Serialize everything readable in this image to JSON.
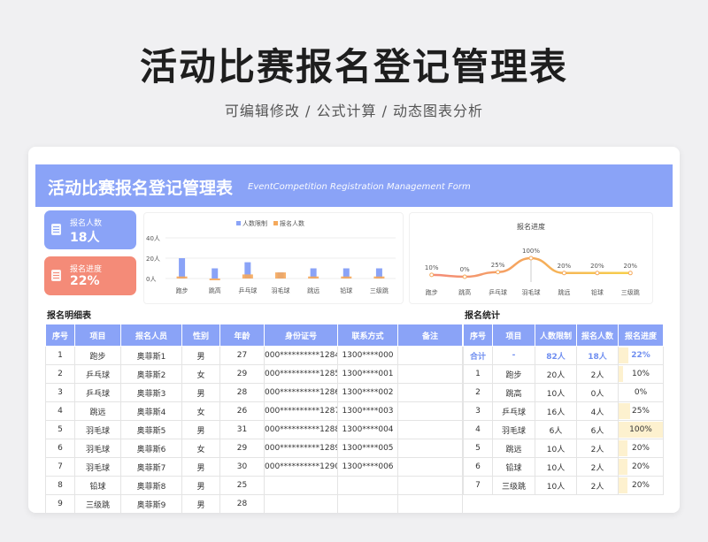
{
  "page": {
    "title": "活动比赛报名登记管理表",
    "subtitle": "可编辑修改 /  公式计算  /  动态图表分析"
  },
  "banner": {
    "title": "活动比赛报名登记管理表",
    "subtitle": "EventCompetition Registration Management Form"
  },
  "stats": {
    "count_label": "报名人数",
    "count_value": "18人",
    "progress_label": "报名进度",
    "progress_value": "22%"
  },
  "colors": {
    "accent": "#8aa3f7",
    "orange": "#f5a95c",
    "coral": "#f48b78",
    "progress_fill": "#fdf1cf"
  },
  "chart_data": [
    {
      "type": "bar",
      "categories": [
        "跑步",
        "跳高",
        "乒乓球",
        "羽毛球",
        "跳远",
        "铅球",
        "三级跳"
      ],
      "series": [
        {
          "name": "人数限制",
          "values": [
            20,
            10,
            16,
            6,
            10,
            10,
            10
          ]
        },
        {
          "name": "报名人数",
          "values": [
            2,
            0,
            4,
            6,
            2,
            2,
            2
          ]
        }
      ],
      "yticks": [
        "40人",
        "20人",
        "0人"
      ],
      "ylim": [
        0,
        40
      ],
      "legend": "top",
      "grid": true
    },
    {
      "type": "line",
      "title": "报名进度",
      "categories": [
        "跑步",
        "跳高",
        "乒乓球",
        "羽毛球",
        "跳远",
        "铅球",
        "三级跳"
      ],
      "values": [
        10,
        0,
        25,
        100,
        20,
        20,
        20
      ],
      "labels": [
        "10%",
        "0%",
        "25%",
        "100%",
        "20%",
        "20%",
        "20%"
      ]
    }
  ],
  "detail": {
    "section_label": "报名明细表",
    "headers": [
      "序号",
      "项目",
      "报名人员",
      "性别",
      "年龄",
      "身份证号",
      "联系方式",
      "备注"
    ],
    "rows": [
      [
        "1",
        "跑步",
        "奥菲斯1",
        "男",
        "27",
        "000**********1284",
        "1300****000",
        ""
      ],
      [
        "2",
        "乒乓球",
        "奥菲斯2",
        "女",
        "29",
        "000**********1285",
        "1300****001",
        ""
      ],
      [
        "3",
        "乒乓球",
        "奥菲斯3",
        "男",
        "28",
        "000**********1286",
        "1300****002",
        ""
      ],
      [
        "4",
        "跳远",
        "奥菲斯4",
        "女",
        "26",
        "000**********1287",
        "1300****003",
        ""
      ],
      [
        "5",
        "羽毛球",
        "奥菲斯5",
        "男",
        "31",
        "000**********1288",
        "1300****004",
        ""
      ],
      [
        "6",
        "羽毛球",
        "奥菲斯6",
        "女",
        "29",
        "000**********1289",
        "1300****005",
        ""
      ],
      [
        "7",
        "羽毛球",
        "奥菲斯7",
        "男",
        "30",
        "000**********1290",
        "1300****006",
        ""
      ],
      [
        "8",
        "铅球",
        "奥菲斯8",
        "男",
        "25",
        "",
        "",
        ""
      ],
      [
        "9",
        "三级跳",
        "奥菲斯9",
        "男",
        "28",
        "",
        "",
        ""
      ]
    ]
  },
  "summary": {
    "section_label": "报名统计",
    "headers": [
      "序号",
      "项目",
      "人数限制",
      "报名人数",
      "报名进度"
    ],
    "total": [
      "合计",
      "-",
      "82人",
      "18人",
      "22%"
    ],
    "rows": [
      [
        "1",
        "跑步",
        "20人",
        "2人",
        "10%"
      ],
      [
        "2",
        "跳高",
        "10人",
        "0人",
        "0%"
      ],
      [
        "3",
        "乒乓球",
        "16人",
        "4人",
        "25%"
      ],
      [
        "4",
        "羽毛球",
        "6人",
        "6人",
        "100%"
      ],
      [
        "5",
        "跳远",
        "10人",
        "2人",
        "20%"
      ],
      [
        "6",
        "铅球",
        "10人",
        "2人",
        "20%"
      ],
      [
        "7",
        "三级跳",
        "10人",
        "2人",
        "20%"
      ]
    ],
    "progress": [
      0.1,
      0.0,
      0.25,
      1.0,
      0.2,
      0.2,
      0.2
    ],
    "total_progress": 0.22
  }
}
